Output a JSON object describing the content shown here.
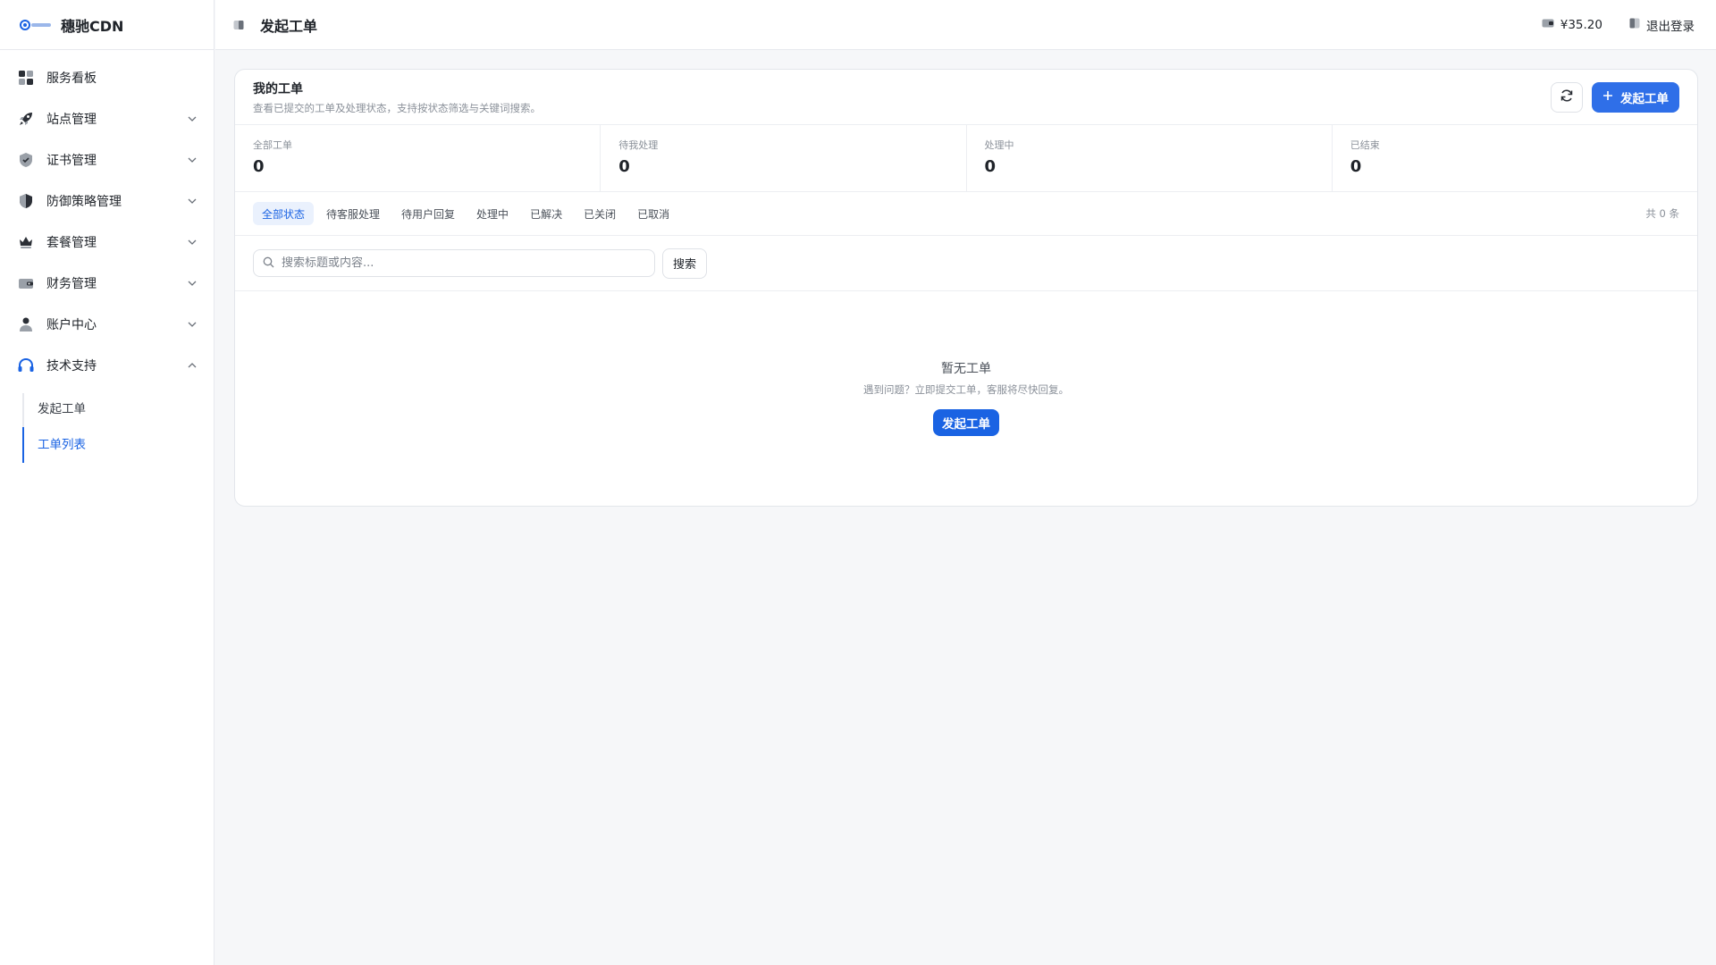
{
  "brand": {
    "name": "穗驰CDN",
    "logo_text": "穗驰CDN"
  },
  "colors": {
    "accent": "#1a63e3",
    "primary_button": "#2f6fe8",
    "page_bg": "#f6f7f9"
  },
  "sidebar": {
    "items": [
      {
        "label": "服务看板",
        "icon": "dashboard-icon"
      },
      {
        "label": "站点管理",
        "icon": "rocket-icon",
        "expandable": true
      },
      {
        "label": "证书管理",
        "icon": "shield-check-icon",
        "expandable": true
      },
      {
        "label": "防御策略管理",
        "icon": "defense-shield-icon",
        "expandable": true
      },
      {
        "label": "套餐管理",
        "icon": "crown-icon",
        "expandable": true
      },
      {
        "label": "财务管理",
        "icon": "wallet-icon",
        "expandable": true
      },
      {
        "label": "账户中心",
        "icon": "user-icon",
        "expandable": true
      },
      {
        "label": "技术支持",
        "icon": "headset-icon",
        "expandable": true,
        "expanded": true
      }
    ],
    "sub_items": [
      {
        "label": "发起工单",
        "active": false
      },
      {
        "label": "工单列表",
        "active": true
      }
    ]
  },
  "topbar": {
    "title": "发起工单",
    "balance": "¥35.20",
    "logout": "退出登录"
  },
  "card": {
    "title": "我的工单",
    "description": "查看已提交的工单及处理状态，支持按状态筛选与关键词搜索。",
    "new_ticket_button": "发起工单",
    "stats": [
      {
        "label": "全部工单",
        "value": "0"
      },
      {
        "label": "待我处理",
        "value": "0"
      },
      {
        "label": "处理中",
        "value": "0"
      },
      {
        "label": "已结束",
        "value": "0"
      }
    ],
    "tabs": [
      {
        "label": "全部状态",
        "active": true
      },
      {
        "label": "待客服处理",
        "active": false
      },
      {
        "label": "待用户回复",
        "active": false
      },
      {
        "label": "处理中",
        "active": false
      },
      {
        "label": "已解决",
        "active": false
      },
      {
        "label": "已关闭",
        "active": false
      },
      {
        "label": "已取消",
        "active": false
      }
    ],
    "count_text": "共 0 条",
    "search": {
      "placeholder": "搜索标题或内容...",
      "value": "",
      "button": "搜索"
    },
    "empty": {
      "title": "暂无工单",
      "description": "遇到问题？立即提交工单，客服将尽快回复。",
      "button": "发起工单"
    }
  }
}
